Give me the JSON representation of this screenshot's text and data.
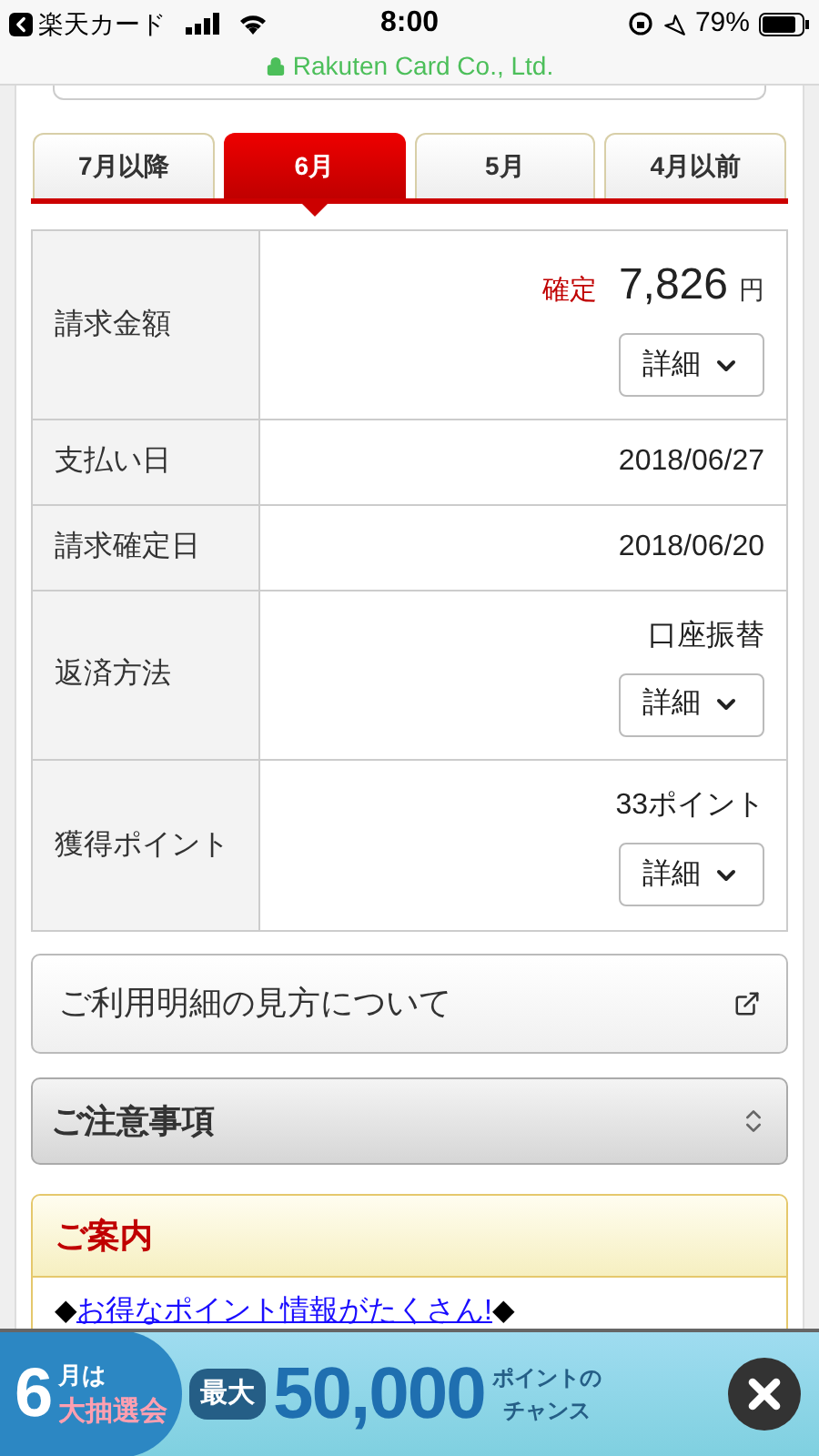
{
  "status_bar": {
    "back_app": "楽天カード",
    "time": "8:00",
    "battery": "79%"
  },
  "url_bar": {
    "site": "Rakuten Card Co., Ltd."
  },
  "tabs": [
    {
      "label": "7月以降",
      "selected": false
    },
    {
      "label": "6月",
      "selected": true
    },
    {
      "label": "5月",
      "selected": false
    },
    {
      "label": "4月以前",
      "selected": false
    }
  ],
  "rows": [
    {
      "label": "請求金額",
      "status": "確定",
      "amount": "7,826",
      "unit": "円",
      "details": "詳細"
    },
    {
      "label": "支払い日",
      "value": "2018/06/27"
    },
    {
      "label": "請求確定日",
      "value": "2018/06/20"
    },
    {
      "label": "返済方法",
      "value": "口座振替",
      "details": "詳細"
    },
    {
      "label": "獲得ポイント",
      "value": "33ポイント",
      "details": "詳細"
    }
  ],
  "guide_link": "ご利用明細の見方について",
  "notes": {
    "title": "ご注意事項",
    "expanded": false
  },
  "info": {
    "title": "ご案内",
    "link": "お得なポイント情報がたくさん!",
    "mark": "◆"
  },
  "banner": {
    "month": "6",
    "month_suffix": "月は",
    "event": "大抽選会",
    "max": "最大",
    "points": "50,000",
    "unit": "ポイントの",
    "chance": "チャンス"
  }
}
